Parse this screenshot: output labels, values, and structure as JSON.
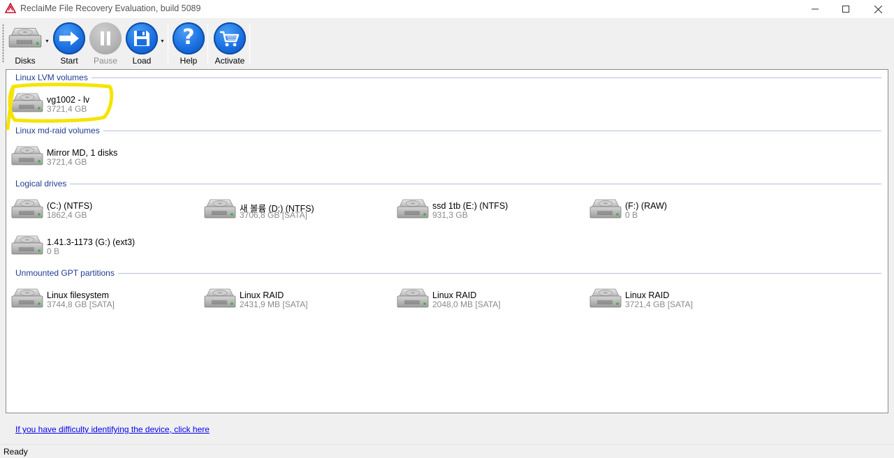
{
  "window": {
    "title": "ReclaiMe File Recovery Evaluation, build 5089",
    "controls": {
      "minimize": "minimize-icon",
      "maximize": "maximize-icon",
      "close": "close-icon"
    }
  },
  "toolbar": {
    "disks_label": "Disks",
    "start_label": "Start",
    "pause_label": "Pause",
    "load_label": "Load",
    "help_label": "Help",
    "activate_label": "Activate"
  },
  "sections": {
    "lvm": {
      "header": "Linux LVM volumes",
      "items": [
        {
          "name": "vg1002 - lv",
          "size": "3721,4 GB"
        }
      ]
    },
    "mdraid": {
      "header": "Linux md-raid volumes",
      "items": [
        {
          "name": "Mirror MD, 1 disks",
          "size": "3721,4 GB"
        }
      ]
    },
    "logical": {
      "header": "Logical drives",
      "items": [
        {
          "name": "(C:) (NTFS)",
          "size": "1862,4 GB"
        },
        {
          "name": "새 볼륨 (D:) (NTFS)",
          "size": "3706,8 GB [SATA]"
        },
        {
          "name": "ssd 1tb (E:) (NTFS)",
          "size": "931,3 GB"
        },
        {
          "name": "(F:) (RAW)",
          "size": "0 B"
        },
        {
          "name": "1.41.3-1173 (G:) (ext3)",
          "size": "0 B"
        }
      ]
    },
    "gpt": {
      "header": "Unmounted GPT partitions",
      "items": [
        {
          "name": "Linux filesystem",
          "size": "3744,8 GB [SATA]"
        },
        {
          "name": "Linux RAID",
          "size": "2431,9 MB [SATA]"
        },
        {
          "name": "Linux RAID",
          "size": "2048,0 MB [SATA]"
        },
        {
          "name": "Linux RAID",
          "size": "3721,4 GB [SATA]"
        }
      ]
    }
  },
  "footer": {
    "help_link": "If you have difficulty identifying the device, click here",
    "status": "Ready"
  },
  "colors": {
    "section_header": "#1e3c94",
    "button_blue": "#1a6fe0",
    "highlight": "#f5e400",
    "link": "#0000ee"
  }
}
